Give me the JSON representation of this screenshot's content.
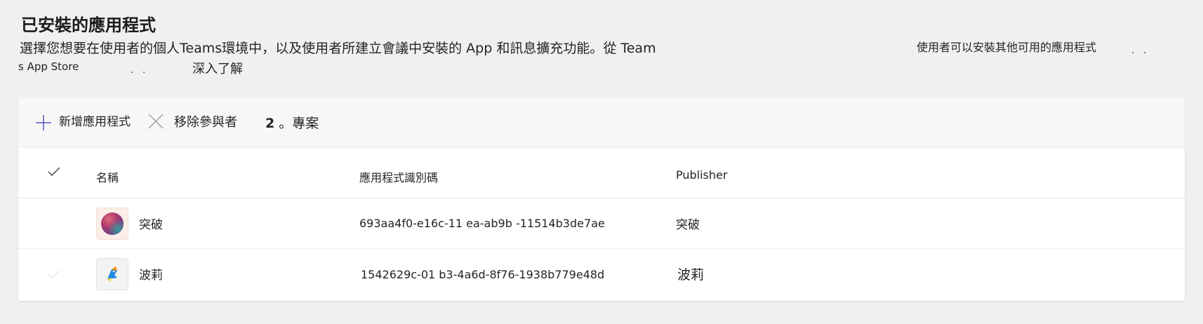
{
  "page": {
    "title": "已安裝的應用程式",
    "description_line1": "選擇您想要在使用者的個人Teams環境中，以及使用者所建立會議中安裝的 App 和訊息擴充功能。從 Team",
    "description_line2": "s App Store",
    "description_dots": ". .",
    "learn_more": "深入了解",
    "right_note": "使用者可以安裝其他可用的應用程式",
    "right_dots": ". ."
  },
  "toolbar": {
    "add_label": "新增應用程式",
    "remove_label": "移除參與者",
    "count": "2",
    "count_suffix": "。專案"
  },
  "table": {
    "columns": [
      "名稱",
      "應用程式識別碼",
      "Publisher"
    ],
    "rows": [
      {
        "name": "突破",
        "app_id": "693aa4f0-e16c-11 ea-ab9b     -11514b3de7ae",
        "publisher": "突破",
        "icon": "breakthru-logo-icon"
      },
      {
        "name": "波莉",
        "app_id": "1542629c-01 b3-4a6d-8f76-1938b779e48d",
        "publisher": "波莉",
        "icon": "polly-logo-icon"
      }
    ]
  },
  "colors": {
    "page_bg": "#f0f0f0",
    "panel_bg": "#ffffff",
    "toolbar_bg": "#f8f7f6",
    "accent": "#5b5fc7"
  }
}
